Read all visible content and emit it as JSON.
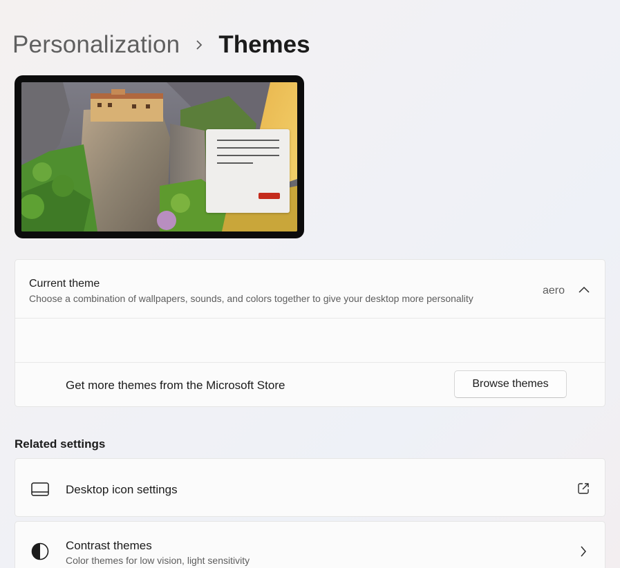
{
  "breadcrumb": {
    "parent": "Personalization",
    "current": "Themes"
  },
  "current_theme": {
    "title": "Current theme",
    "description": "Choose a combination of wallpapers, sounds, and colors together to give your desktop more personality",
    "value": "aero",
    "expanded": true
  },
  "store": {
    "text": "Get more themes from the Microsoft Store",
    "button_label": "Browse themes"
  },
  "related": {
    "heading": "Related settings",
    "items": [
      {
        "title": "Desktop icon settings",
        "icon": "monitor-icon",
        "end_icon": "open-external-icon"
      },
      {
        "title": "Contrast themes",
        "subtitle": "Color themes for low vision, light sensitivity",
        "icon": "contrast-icon",
        "end_icon": "chevron-right-icon"
      }
    ]
  },
  "colors": {
    "accent_button": "#c42b1c",
    "card_background": "#fbfbfb"
  }
}
